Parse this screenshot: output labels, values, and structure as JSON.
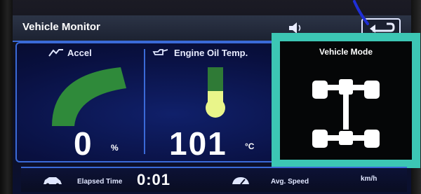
{
  "header": {
    "title": "Vehicle Monitor",
    "speaker_icon": "speaker-icon",
    "back_icon": "back-arrow-icon"
  },
  "accel": {
    "label": "Accel",
    "icon": "accel-icon",
    "value": "0",
    "unit": "%",
    "gauge_level": 0.0,
    "gauge_color": "#2f8a3a"
  },
  "oil": {
    "label": "Engine Oil Temp.",
    "icon": "oil-can-icon",
    "value": "101",
    "unit": "°C",
    "thermometer_level": 0.5,
    "fill_color": "#e9f58a",
    "empty_color": "#2f7a36"
  },
  "mode": {
    "title": "Vehicle Mode",
    "icon": "awd-drivetrain-icon",
    "highlight_color": "#3cc6b4"
  },
  "footer": {
    "elapsed_icon": "car-icon",
    "elapsed_label": "Elapsed Time",
    "elapsed_value": "0:01",
    "speed_icon": "speed-icon",
    "avg_speed_label": "Avg. Speed",
    "speed_unit": "km/h"
  },
  "colors": {
    "accent": "#3a6ad8",
    "background": "#0b1030"
  }
}
